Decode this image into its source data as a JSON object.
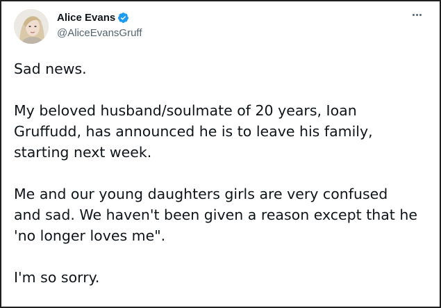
{
  "author": {
    "display_name": "Alice Evans",
    "handle": "@AliceEvansGruff",
    "verified": true
  },
  "icons": {
    "avatar": "profile-photo",
    "verified": "verified-badge-icon",
    "more": "more-options-icon"
  },
  "colors": {
    "text_primary": "#0f1419",
    "text_secondary": "#536471",
    "verified_blue": "#1d9bf0"
  },
  "tweet": {
    "paragraphs": [
      "Sad news.",
      "My beloved husband/soulmate of 20 years, Ioan\nGruffudd, has announced he is to leave his family,\nstarting next week.",
      "Me and our young daughters girls are very confused\nand sad. We haven't been given a reason except that he\n'no longer loves me\".",
      "I'm so sorry."
    ]
  }
}
